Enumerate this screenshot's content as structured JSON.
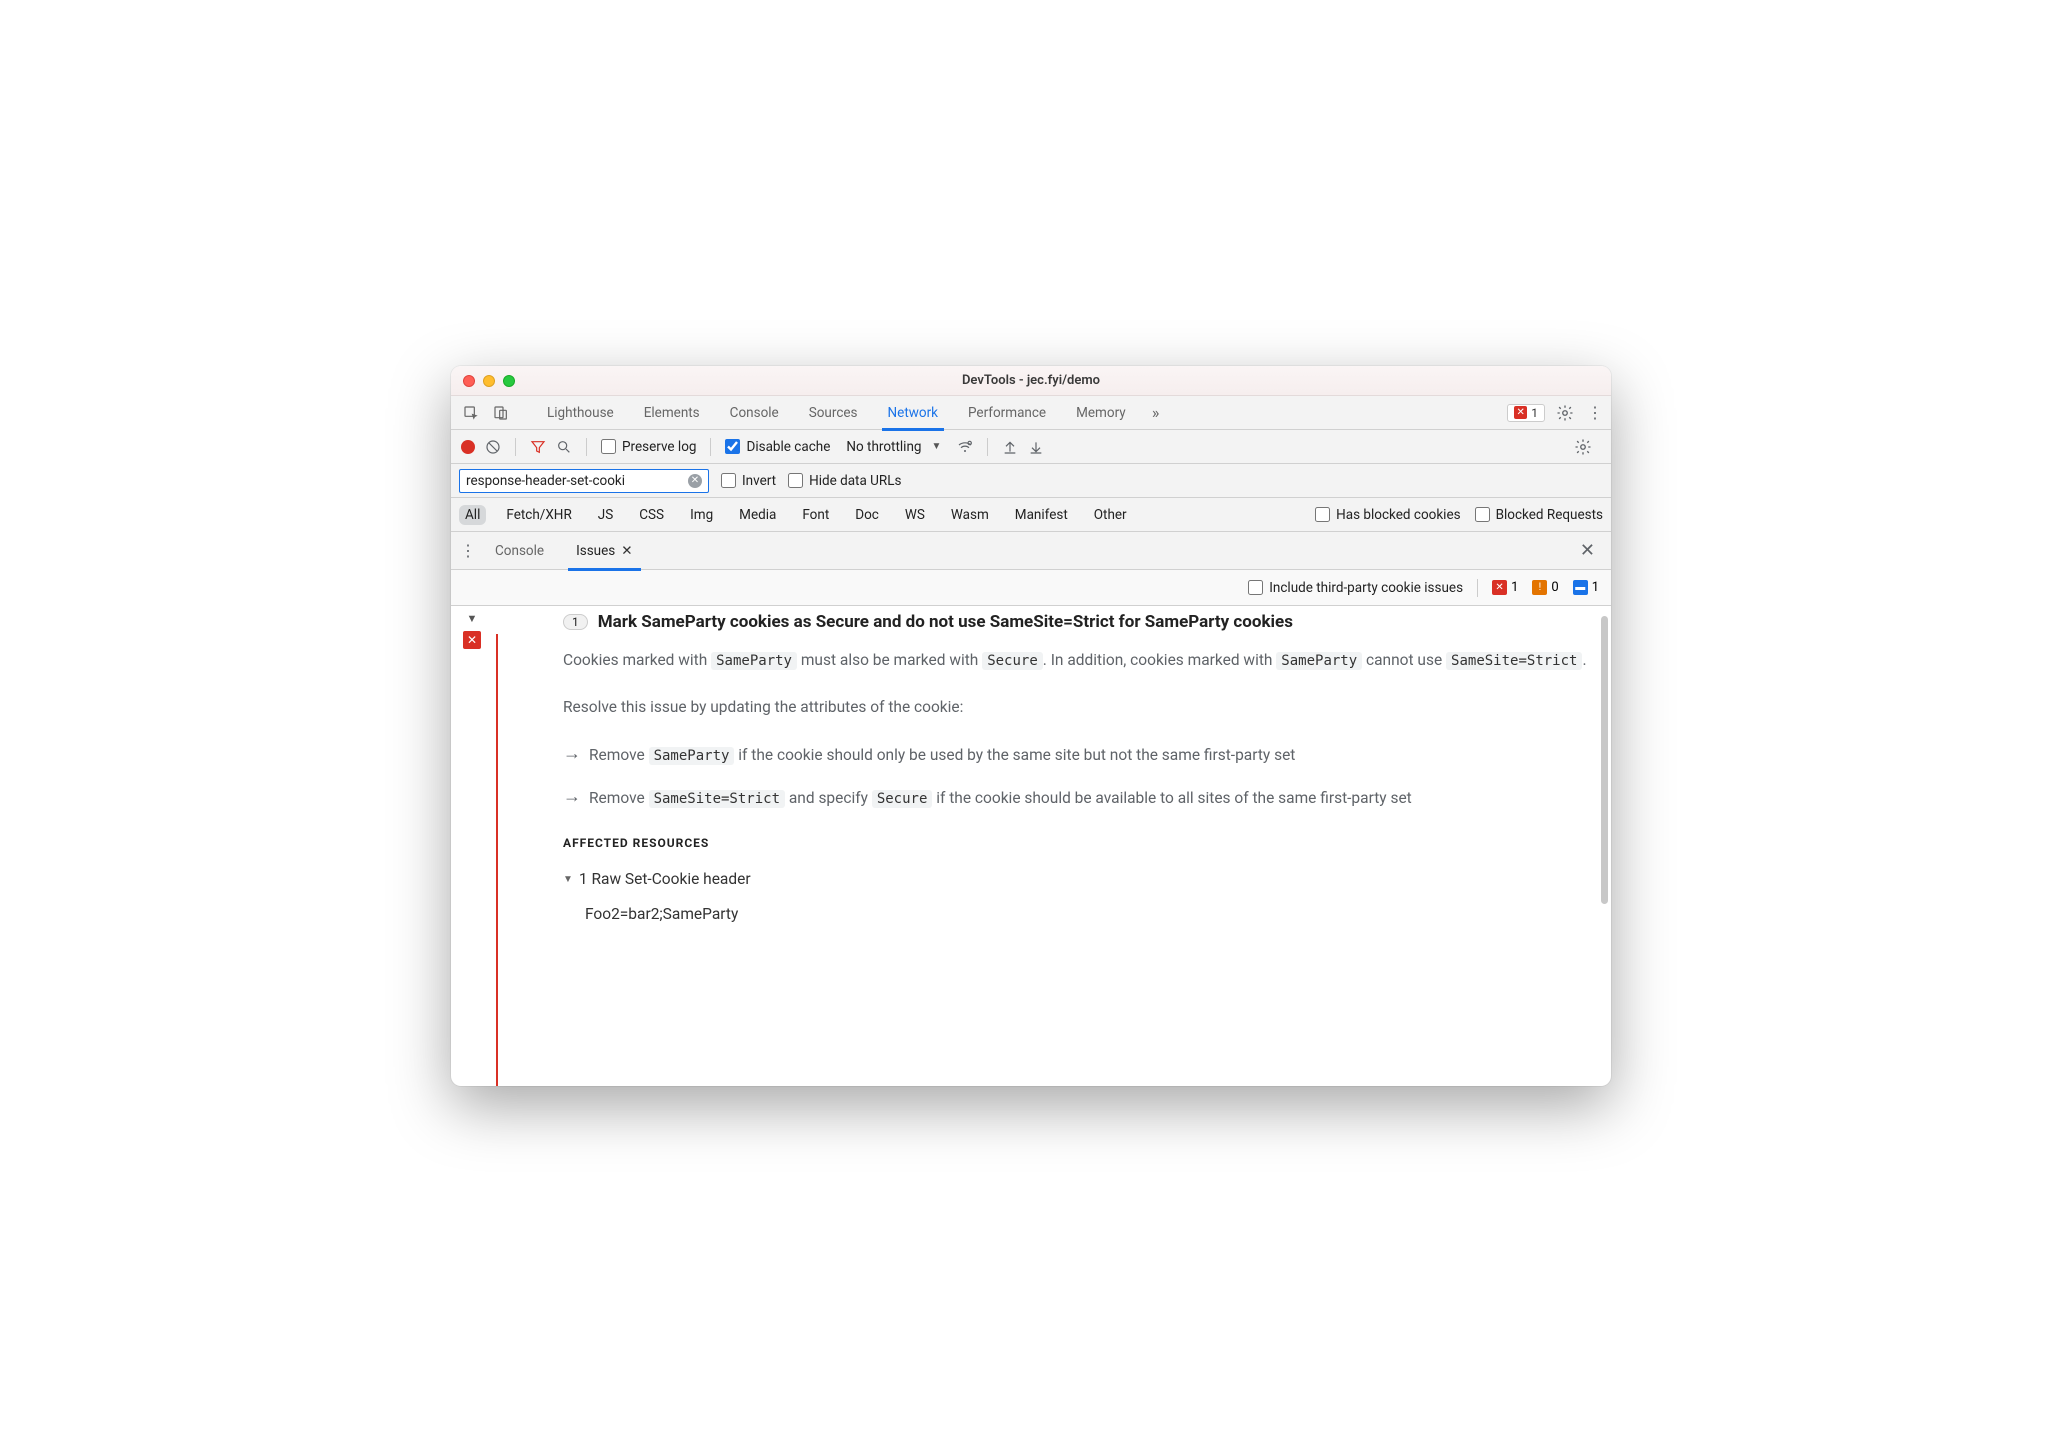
{
  "window_title": "DevTools - jec.fyi/demo",
  "tabs": {
    "items": [
      "Lighthouse",
      "Elements",
      "Console",
      "Sources",
      "Network",
      "Performance",
      "Memory"
    ],
    "active": "Network",
    "overflow_icon": "chevron-double-right-icon"
  },
  "error_counter": {
    "count": "1"
  },
  "toolbar2": {
    "preserve_log_label": "Preserve log",
    "preserve_log_checked": false,
    "disable_cache_label": "Disable cache",
    "disable_cache_checked": true,
    "throttling_label": "No throttling"
  },
  "filterbar": {
    "filter_value": "response-header-set-cooki",
    "invert_label": "Invert",
    "hide_data_urls_label": "Hide data URLs"
  },
  "types": {
    "items": [
      "All",
      "Fetch/XHR",
      "JS",
      "CSS",
      "Img",
      "Media",
      "Font",
      "Doc",
      "WS",
      "Wasm",
      "Manifest",
      "Other"
    ],
    "selected": "All",
    "has_blocked_cookies_label": "Has blocked cookies",
    "blocked_requests_label": "Blocked Requests"
  },
  "drawer": {
    "tabs": [
      "Console",
      "Issues"
    ],
    "active": "Issues"
  },
  "issueopts": {
    "include_label": "Include third-party cookie issues",
    "err_count": "1",
    "warn_count": "0",
    "info_count": "1"
  },
  "issue": {
    "count": "1",
    "title": "Mark SameParty cookies as Secure and do not use SameSite=Strict for SameParty cookies",
    "p1_a": "Cookies marked with ",
    "p1_c1": "SameParty",
    "p1_b": " must also be marked with ",
    "p1_c2": "Secure",
    "p1_c": ". In addition, cookies marked with ",
    "p1_c3": "SameParty",
    "p1_d": " cannot use ",
    "p1_c4": "SameSite=Strict",
    "p1_e": ".",
    "p2": "Resolve this issue by updating the attributes of the cookie:",
    "b1_a": "Remove ",
    "b1_c": "SameParty",
    "b1_b": " if the cookie should only be used by the same site but not the same first-party set",
    "b2_a": "Remove ",
    "b2_c1": "SameSite=Strict",
    "b2_b": " and specify ",
    "b2_c2": "Secure",
    "b2_c": " if the cookie should be available to all sites of the same first-party set",
    "affected_heading": "AFFECTED RESOURCES",
    "affected_row": "1 Raw Set-Cookie header",
    "affected_value": "Foo2=bar2;SameParty"
  }
}
